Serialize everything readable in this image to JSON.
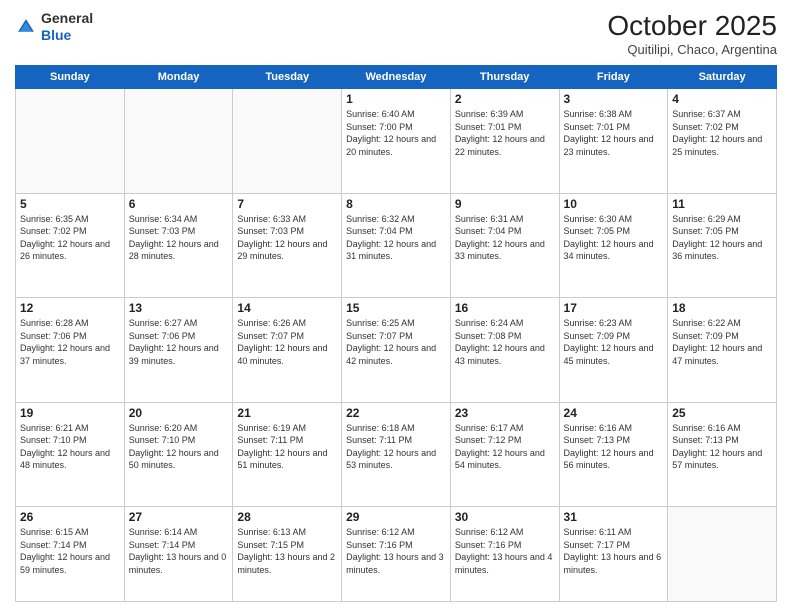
{
  "header": {
    "logo_general": "General",
    "logo_blue": "Blue",
    "month": "October 2025",
    "location": "Quitilipi, Chaco, Argentina"
  },
  "weekdays": [
    "Sunday",
    "Monday",
    "Tuesday",
    "Wednesday",
    "Thursday",
    "Friday",
    "Saturday"
  ],
  "weeks": [
    [
      {
        "day": "",
        "info": ""
      },
      {
        "day": "",
        "info": ""
      },
      {
        "day": "",
        "info": ""
      },
      {
        "day": "1",
        "info": "Sunrise: 6:40 AM\nSunset: 7:00 PM\nDaylight: 12 hours\nand 20 minutes."
      },
      {
        "day": "2",
        "info": "Sunrise: 6:39 AM\nSunset: 7:01 PM\nDaylight: 12 hours\nand 22 minutes."
      },
      {
        "day": "3",
        "info": "Sunrise: 6:38 AM\nSunset: 7:01 PM\nDaylight: 12 hours\nand 23 minutes."
      },
      {
        "day": "4",
        "info": "Sunrise: 6:37 AM\nSunset: 7:02 PM\nDaylight: 12 hours\nand 25 minutes."
      }
    ],
    [
      {
        "day": "5",
        "info": "Sunrise: 6:35 AM\nSunset: 7:02 PM\nDaylight: 12 hours\nand 26 minutes."
      },
      {
        "day": "6",
        "info": "Sunrise: 6:34 AM\nSunset: 7:03 PM\nDaylight: 12 hours\nand 28 minutes."
      },
      {
        "day": "7",
        "info": "Sunrise: 6:33 AM\nSunset: 7:03 PM\nDaylight: 12 hours\nand 29 minutes."
      },
      {
        "day": "8",
        "info": "Sunrise: 6:32 AM\nSunset: 7:04 PM\nDaylight: 12 hours\nand 31 minutes."
      },
      {
        "day": "9",
        "info": "Sunrise: 6:31 AM\nSunset: 7:04 PM\nDaylight: 12 hours\nand 33 minutes."
      },
      {
        "day": "10",
        "info": "Sunrise: 6:30 AM\nSunset: 7:05 PM\nDaylight: 12 hours\nand 34 minutes."
      },
      {
        "day": "11",
        "info": "Sunrise: 6:29 AM\nSunset: 7:05 PM\nDaylight: 12 hours\nand 36 minutes."
      }
    ],
    [
      {
        "day": "12",
        "info": "Sunrise: 6:28 AM\nSunset: 7:06 PM\nDaylight: 12 hours\nand 37 minutes."
      },
      {
        "day": "13",
        "info": "Sunrise: 6:27 AM\nSunset: 7:06 PM\nDaylight: 12 hours\nand 39 minutes."
      },
      {
        "day": "14",
        "info": "Sunrise: 6:26 AM\nSunset: 7:07 PM\nDaylight: 12 hours\nand 40 minutes."
      },
      {
        "day": "15",
        "info": "Sunrise: 6:25 AM\nSunset: 7:07 PM\nDaylight: 12 hours\nand 42 minutes."
      },
      {
        "day": "16",
        "info": "Sunrise: 6:24 AM\nSunset: 7:08 PM\nDaylight: 12 hours\nand 43 minutes."
      },
      {
        "day": "17",
        "info": "Sunrise: 6:23 AM\nSunset: 7:09 PM\nDaylight: 12 hours\nand 45 minutes."
      },
      {
        "day": "18",
        "info": "Sunrise: 6:22 AM\nSunset: 7:09 PM\nDaylight: 12 hours\nand 47 minutes."
      }
    ],
    [
      {
        "day": "19",
        "info": "Sunrise: 6:21 AM\nSunset: 7:10 PM\nDaylight: 12 hours\nand 48 minutes."
      },
      {
        "day": "20",
        "info": "Sunrise: 6:20 AM\nSunset: 7:10 PM\nDaylight: 12 hours\nand 50 minutes."
      },
      {
        "day": "21",
        "info": "Sunrise: 6:19 AM\nSunset: 7:11 PM\nDaylight: 12 hours\nand 51 minutes."
      },
      {
        "day": "22",
        "info": "Sunrise: 6:18 AM\nSunset: 7:11 PM\nDaylight: 12 hours\nand 53 minutes."
      },
      {
        "day": "23",
        "info": "Sunrise: 6:17 AM\nSunset: 7:12 PM\nDaylight: 12 hours\nand 54 minutes."
      },
      {
        "day": "24",
        "info": "Sunrise: 6:16 AM\nSunset: 7:13 PM\nDaylight: 12 hours\nand 56 minutes."
      },
      {
        "day": "25",
        "info": "Sunrise: 6:16 AM\nSunset: 7:13 PM\nDaylight: 12 hours\nand 57 minutes."
      }
    ],
    [
      {
        "day": "26",
        "info": "Sunrise: 6:15 AM\nSunset: 7:14 PM\nDaylight: 12 hours\nand 59 minutes."
      },
      {
        "day": "27",
        "info": "Sunrise: 6:14 AM\nSunset: 7:14 PM\nDaylight: 13 hours\nand 0 minutes."
      },
      {
        "day": "28",
        "info": "Sunrise: 6:13 AM\nSunset: 7:15 PM\nDaylight: 13 hours\nand 2 minutes."
      },
      {
        "day": "29",
        "info": "Sunrise: 6:12 AM\nSunset: 7:16 PM\nDaylight: 13 hours\nand 3 minutes."
      },
      {
        "day": "30",
        "info": "Sunrise: 6:12 AM\nSunset: 7:16 PM\nDaylight: 13 hours\nand 4 minutes."
      },
      {
        "day": "31",
        "info": "Sunrise: 6:11 AM\nSunset: 7:17 PM\nDaylight: 13 hours\nand 6 minutes."
      },
      {
        "day": "",
        "info": ""
      }
    ]
  ]
}
